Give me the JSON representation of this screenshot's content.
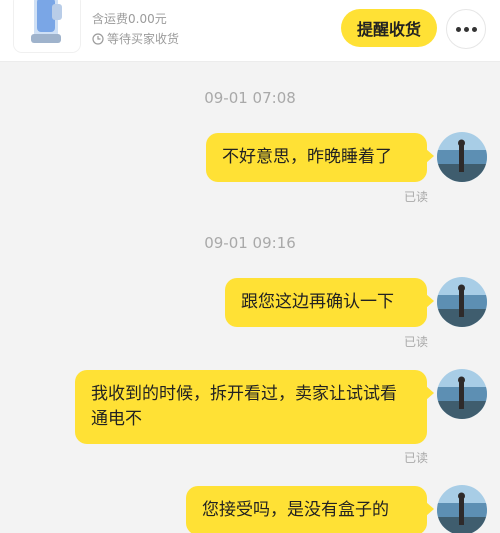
{
  "order": {
    "shipping_text": "含运费0.00元",
    "status_text": "等待买家收货",
    "confirm_label": "提醒收货"
  },
  "messages": [
    {
      "time": "09-01 07:08",
      "text": "不好意思，昨晚睡着了",
      "read": "已读"
    },
    {
      "time": "09-01 09:16",
      "text": "跟您这边再确认一下",
      "read": "已读"
    },
    {
      "time": "",
      "text": "我收到的时候，拆开看过，卖家让试试看通电不",
      "read": "已读"
    },
    {
      "time": "",
      "text": "您接受吗，是没有盒子的",
      "read": ""
    }
  ],
  "colors": {
    "bubble": "#ffe135",
    "background": "#f3f3f3"
  },
  "icons": [
    "product-image",
    "clock-icon",
    "more-icon",
    "avatar"
  ]
}
